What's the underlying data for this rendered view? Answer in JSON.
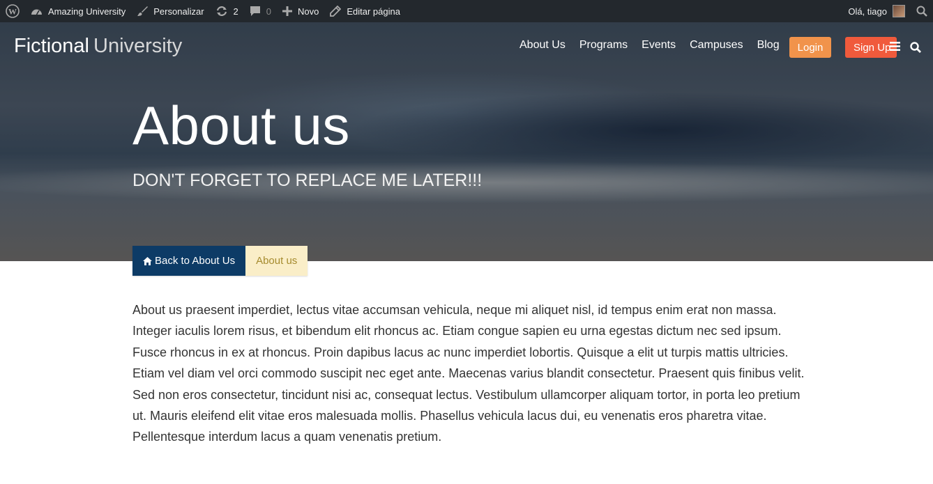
{
  "adminbar": {
    "site_name": "Amazing University",
    "customize": "Personalizar",
    "updates_count": "2",
    "comments_count": "0",
    "new_label": "Novo",
    "edit_page": "Editar página",
    "greeting": "Olá, tiago",
    "icons": [
      "wordpress-icon",
      "dashboard-icon",
      "brush-icon",
      "refresh-icon",
      "comment-icon",
      "plus-icon",
      "pencil-icon",
      "search-icon"
    ]
  },
  "header": {
    "logo_bold": "Fictional",
    "logo_light": "University",
    "nav": [
      "About Us",
      "Programs",
      "Events",
      "Campuses",
      "Blog"
    ],
    "login": "Login",
    "signup": "Sign Up"
  },
  "hero": {
    "title": "About us",
    "subtitle": "DON'T FORGET TO REPLACE ME LATER!!!"
  },
  "breadcrumb": {
    "back_label": "Back to About Us",
    "current": "About us"
  },
  "content": {
    "paragraph": "About us praesent imperdiet, lectus vitae accumsan vehicula, neque mi aliquet nisl, id tempus enim erat non massa. Integer iaculis lorem risus, et bibendum elit rhoncus ac. Etiam congue sapien eu urna egestas dictum nec sed ipsum. Fusce rhoncus in ex at rhoncus. Proin dapibus lacus ac nunc imperdiet lobortis. Quisque a elit ut turpis mattis ultricies. Etiam vel diam vel orci commodo suscipit nec eget ante. Maecenas varius blandit consectetur. Praesent quis finibus velit. Sed non eros consectetur, tincidunt nisi ac, consequat lectus. Vestibulum ullamcorper aliquam tortor, in porta leo pretium ut. Mauris eleifend elit vitae eros malesuada mollis. Phasellus vehicula lacus dui, eu venenatis eros pharetra vitae. Pellentesque interdum lacus a quam venenatis pretium."
  },
  "colors": {
    "adminbar_bg": "#23282d",
    "login": "#f1934b",
    "signup": "#f05a3c",
    "breadcrumb_back": "#0d3b66",
    "breadcrumb_current_bg": "#faeec8",
    "breadcrumb_current_text": "#a58b2e"
  }
}
